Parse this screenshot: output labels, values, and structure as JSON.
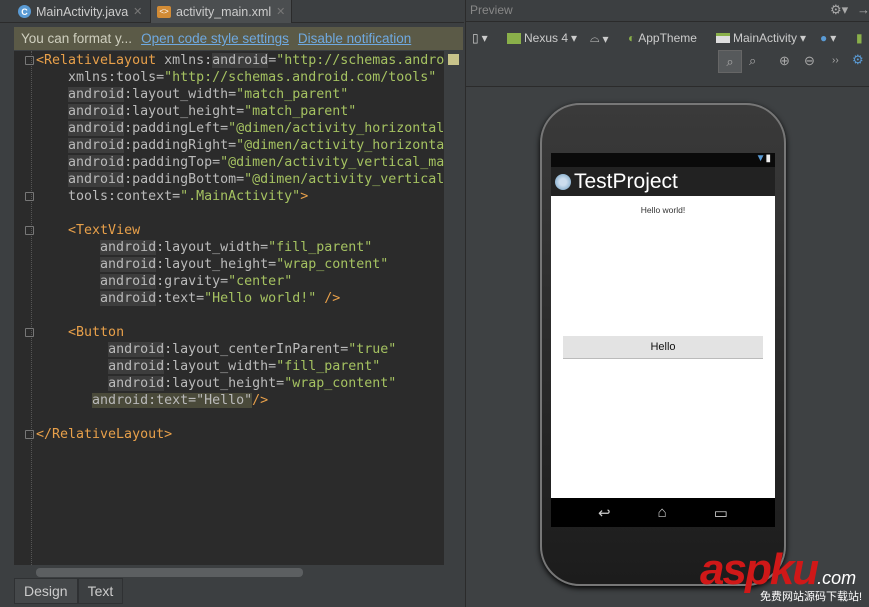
{
  "tabs": [
    {
      "label": "MainActivity.java",
      "icon": "C"
    },
    {
      "label": "activity_main.xml",
      "icon": "<>"
    }
  ],
  "notification": {
    "text": "You can format y...",
    "link1": "Open code style settings",
    "link2": "Disable notification"
  },
  "code": [
    [
      [
        "t",
        "<RelativeLayout"
      ],
      [
        "",
        "xmlns:"
      ],
      [
        "ns",
        "android"
      ],
      [
        "",
        "="
      ],
      [
        "v",
        "\"http://schemas.andro"
      ]
    ],
    [
      [
        "",
        "    xmlns:tools="
      ],
      [
        "v",
        "\"http://schemas.android.com/tools\""
      ]
    ],
    [
      [
        "",
        "    "
      ],
      [
        "ns",
        "android"
      ],
      [
        "",
        ":layout_width="
      ],
      [
        "v",
        "\"match_parent\""
      ]
    ],
    [
      [
        "",
        "    "
      ],
      [
        "ns",
        "android"
      ],
      [
        "",
        ":layout_height="
      ],
      [
        "v",
        "\"match_parent\""
      ]
    ],
    [
      [
        "",
        "    "
      ],
      [
        "ns",
        "android"
      ],
      [
        "",
        ":paddingLeft="
      ],
      [
        "v",
        "\"@dimen/activity_horizontal"
      ]
    ],
    [
      [
        "",
        "    "
      ],
      [
        "ns",
        "android"
      ],
      [
        "",
        ":paddingRight="
      ],
      [
        "v",
        "\"@dimen/activity_horizonta"
      ]
    ],
    [
      [
        "",
        "    "
      ],
      [
        "ns",
        "android"
      ],
      [
        "",
        ":paddingTop="
      ],
      [
        "v",
        "\"@dimen/activity_vertical_ma"
      ]
    ],
    [
      [
        "",
        "    "
      ],
      [
        "ns",
        "android"
      ],
      [
        "",
        ":paddingBottom="
      ],
      [
        "v",
        "\"@dimen/activity_vertical"
      ]
    ],
    [
      [
        "",
        "    tools:context="
      ],
      [
        "v",
        "\".MainActivity\""
      ],
      [
        "t",
        ">"
      ]
    ],
    [],
    [
      [
        "",
        "    "
      ],
      [
        "t",
        "<TextView"
      ]
    ],
    [
      [
        "",
        "        "
      ],
      [
        "ns",
        "android"
      ],
      [
        "",
        ":layout_width="
      ],
      [
        "v",
        "\"fill_parent\""
      ]
    ],
    [
      [
        "",
        "        "
      ],
      [
        "ns",
        "android"
      ],
      [
        "",
        ":layout_height="
      ],
      [
        "v",
        "\"wrap_content\""
      ]
    ],
    [
      [
        "",
        "        "
      ],
      [
        "ns",
        "android"
      ],
      [
        "",
        ":gravity="
      ],
      [
        "v",
        "\"center\""
      ]
    ],
    [
      [
        "",
        "        "
      ],
      [
        "ns",
        "android"
      ],
      [
        "",
        ":text="
      ],
      [
        "v",
        "\"Hello world!\""
      ],
      [
        "t",
        " />"
      ]
    ],
    [],
    [
      [
        "",
        "    "
      ],
      [
        "t",
        "<Button"
      ]
    ],
    [
      [
        "",
        "         "
      ],
      [
        "ns",
        "android"
      ],
      [
        "",
        ":layout_centerInParent="
      ],
      [
        "v",
        "\"true\""
      ]
    ],
    [
      [
        "",
        "         "
      ],
      [
        "ns",
        "android"
      ],
      [
        "",
        ":layout_width="
      ],
      [
        "v",
        "\"fill_parent\""
      ]
    ],
    [
      [
        "",
        "         "
      ],
      [
        "ns",
        "android"
      ],
      [
        "",
        ":layout_height="
      ],
      [
        "v",
        "\"wrap_content\""
      ]
    ],
    [
      [
        "",
        "       "
      ],
      [
        "hl",
        "android:text=\"Hello\""
      ],
      [
        "t",
        "/>"
      ]
    ],
    [],
    [
      [
        "t",
        "</RelativeLayout>"
      ]
    ]
  ],
  "bottom_tabs": {
    "design": "Design",
    "text": "Text"
  },
  "preview": {
    "title": "Preview",
    "device": "Nexus 4",
    "theme": "AppTheme",
    "activity": "MainActivity"
  },
  "app": {
    "title": "TestProject",
    "hello": "Hello world!",
    "button": "Hello"
  },
  "watermark": {
    "brand": "aspku",
    ".com": ".com",
    "slogan": "免费网站源码下载站!"
  },
  "colors": {
    "tag": "#e8a04a",
    "value": "#a5c261",
    "accent": "#6fa9e0"
  }
}
